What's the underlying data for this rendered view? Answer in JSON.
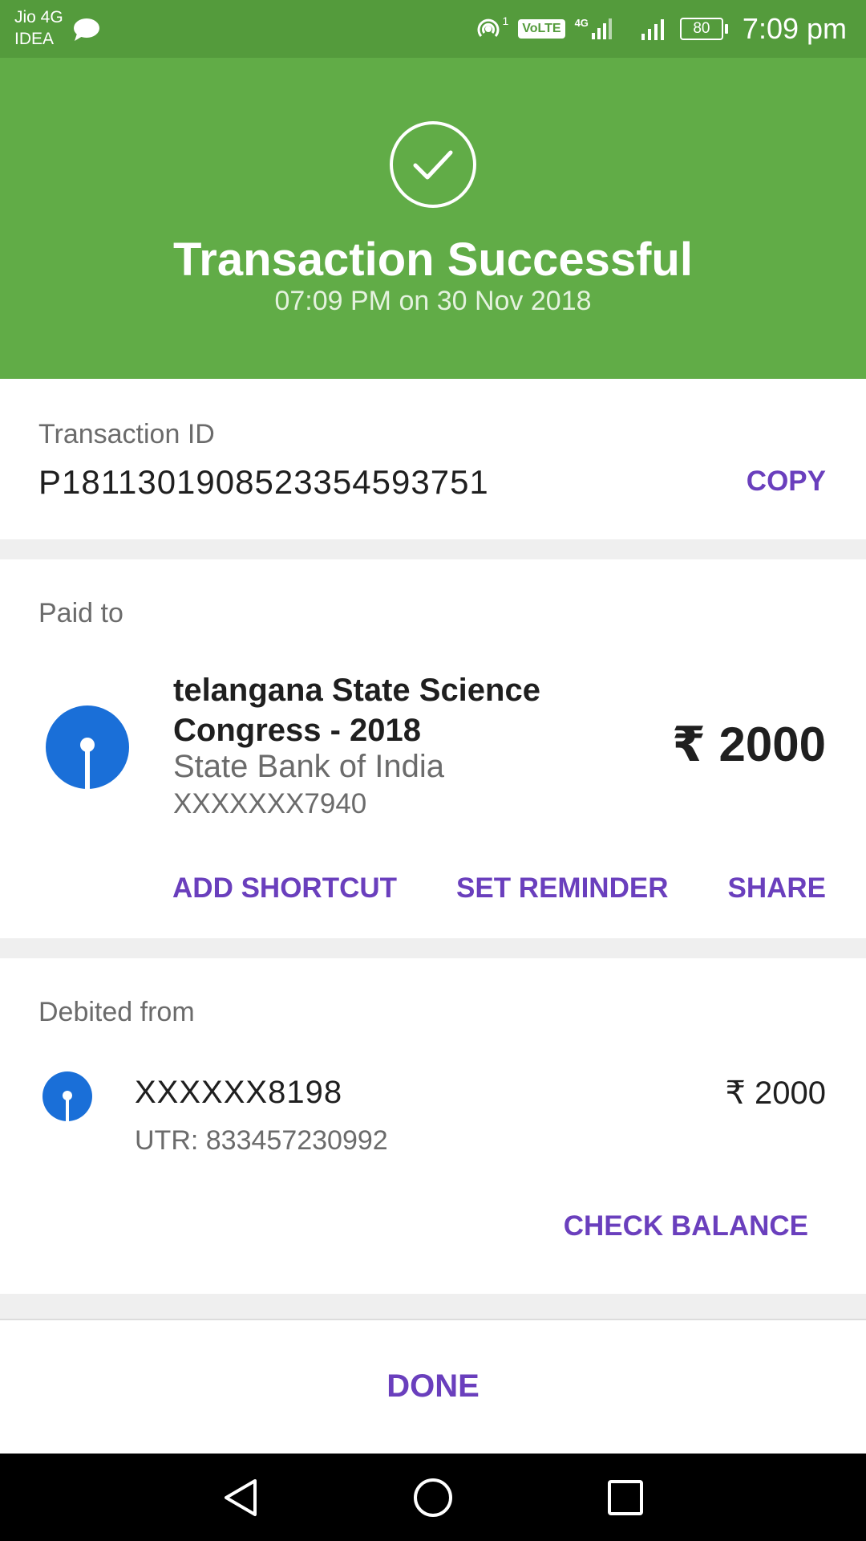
{
  "status_bar": {
    "carrier_line1": "Jio 4G",
    "carrier_line2": "IDEA",
    "volte": "VoLTE",
    "battery": "80",
    "time": "7:09 pm",
    "hotspot_badge": "1",
    "network_type": "4G"
  },
  "header": {
    "title": "Transaction Successful",
    "subtitle": "07:09 PM on 30 Nov 2018",
    "bg_color": "#61ac47"
  },
  "transaction": {
    "label": "Transaction ID",
    "id": "P1811301908523354593751",
    "copy_label": "COPY"
  },
  "paid_to": {
    "label": "Paid to",
    "name": "telangana State Science Congress - 2018",
    "bank": "State Bank of India",
    "account": "XXXXXXX7940",
    "amount": "₹ 2000",
    "actions": {
      "add_shortcut": "ADD SHORTCUT",
      "set_reminder": "SET REMINDER",
      "share": "SHARE"
    }
  },
  "debited_from": {
    "label": "Debited from",
    "account": "XXXXXX8198",
    "utr": "UTR: 833457230992",
    "amount": "₹ 2000",
    "check_balance": "CHECK BALANCE"
  },
  "footer": {
    "done_label": "DONE"
  },
  "icons": {
    "status": [
      "chat-icon",
      "hotspot-icon",
      "signal-icon",
      "battery-icon"
    ],
    "header": "check-circle-icon",
    "bank": "sbi-logo-icon",
    "nav": [
      "back-icon",
      "home-icon",
      "recents-icon"
    ]
  },
  "colors": {
    "accent": "#6a3fbd",
    "sbi_blue": "#1a6fd8",
    "status_bar": "#549b3c"
  }
}
